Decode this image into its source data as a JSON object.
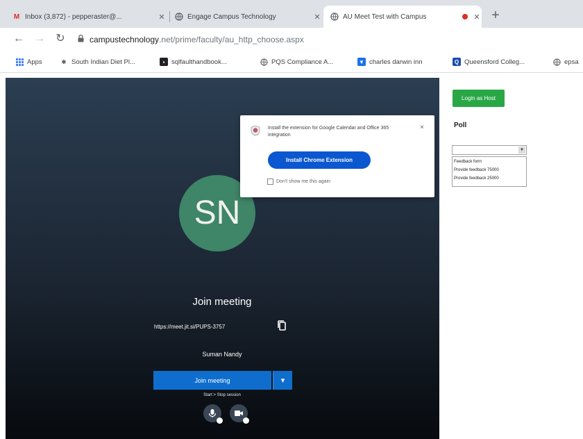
{
  "browser": {
    "tabs": [
      {
        "favicon": "gmail-icon",
        "label": "Inbox (3,872) - pepperaster@...",
        "active": false
      },
      {
        "favicon": "globe-icon",
        "label": "Engage Campus Technology",
        "active": false
      },
      {
        "favicon": "globe-icon",
        "label": "AU Meet Test with Campus",
        "active": true
      }
    ],
    "new_tab_label": "+",
    "address": {
      "domain": "campustechnology",
      "path": ".net/prime/faculty/au_http_choose.aspx"
    },
    "bookmarks": [
      {
        "label": "Apps",
        "icon": "apps-grid-icon",
        "color": "#4285f4"
      },
      {
        "label": "South Indian Diet Pl...",
        "icon": "pin-icon",
        "color": "#5f6368"
      },
      {
        "label": "sqlfaulthandbook...",
        "icon": "document-icon",
        "color": "#202124"
      },
      {
        "label": "PQS Compliance A...",
        "icon": "globe-icon",
        "color": "#5f6368"
      },
      {
        "label": "charles darwin inn",
        "icon": "bookmark-icon",
        "color": "#1a73e8"
      },
      {
        "label": "Queensford Colleg...",
        "icon": "bookmark-icon",
        "color": "#1a4ea8"
      },
      {
        "label": "epsa",
        "icon": "globe-icon",
        "color": "#5f6368"
      }
    ]
  },
  "meeting": {
    "avatar_initials": "SN",
    "join_title": "Join meeting",
    "meeting_url": "https://meet.jit.si/PUPS-3757",
    "display_name": "Suman Nandy",
    "join_button": "Join meeting",
    "alt_option": "Start > Stop session",
    "colors": {
      "avatar": "#3f8567",
      "join": "#0f6ecd"
    }
  },
  "popup": {
    "text": "Install the extension for Google Calendar and Office 365 integration",
    "install_button": "Install Chrome Extension",
    "dont_show": "Don't show me this again"
  },
  "right_panel": {
    "button": "Login as Host",
    "poll_label": "Poll",
    "options": [
      "Feedback form",
      "Provide feedback 75000",
      "Provide feedback 25000"
    ],
    "colors": {
      "button": "#29a745"
    }
  }
}
